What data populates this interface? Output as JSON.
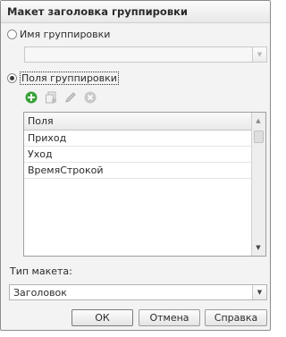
{
  "dialog": {
    "title": "Макет заголовка группировки"
  },
  "group_name_option": {
    "label": "Имя группировки",
    "selected": false,
    "field_value": ""
  },
  "group_fields_option": {
    "label": "Поля группировки",
    "selected": true
  },
  "toolbar": {
    "icons": [
      "add-icon",
      "copy-icon",
      "edit-icon",
      "delete-icon"
    ]
  },
  "fields_table": {
    "column_header": "Поля",
    "rows": [
      "Приход",
      "Уход",
      "ВремяСтрокой"
    ]
  },
  "layout_type": {
    "label": "Тип макета:",
    "value": "Заголовок"
  },
  "buttons": {
    "ok": "ОК",
    "cancel": "Отмена",
    "help": "Справка"
  },
  "colors": {
    "add_green": "#3aa23a",
    "delete_gray": "#c9c9c9"
  }
}
